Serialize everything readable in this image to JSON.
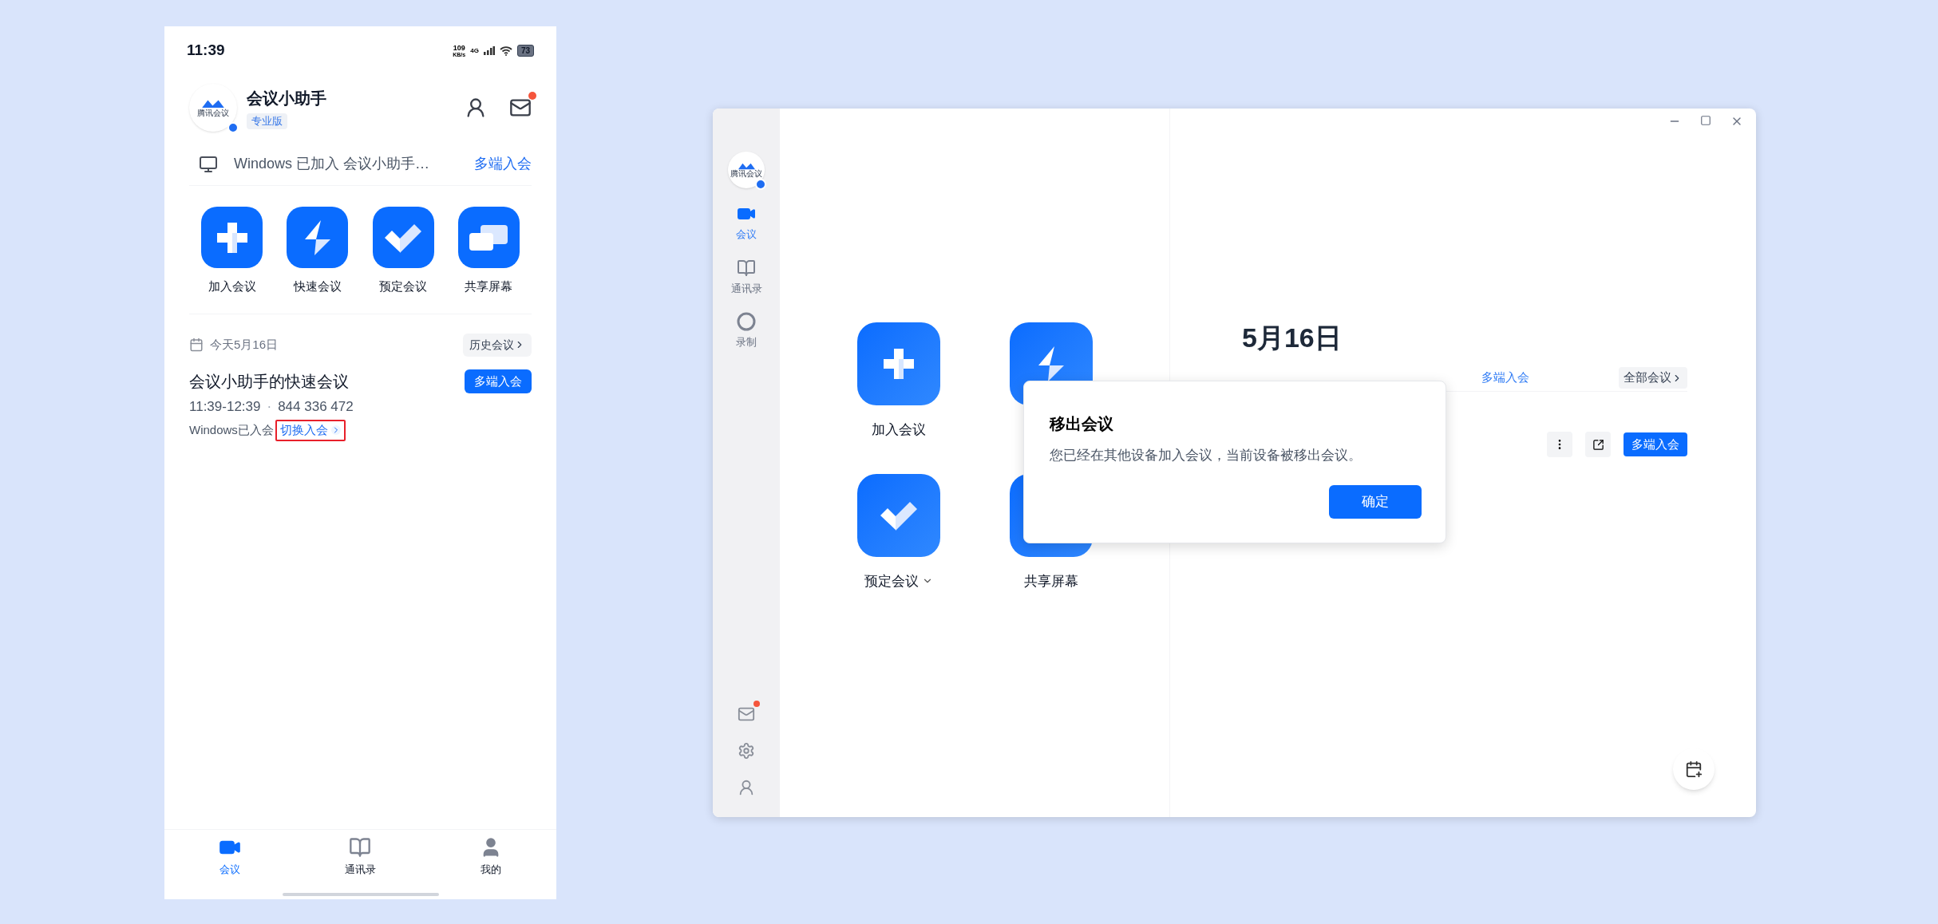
{
  "phone": {
    "status_bar": {
      "time": "11:39",
      "net_speed": "109",
      "net_unit": "KB/s",
      "network": "4G",
      "battery": "73"
    },
    "profile": {
      "logo_text": "腾讯会议",
      "name": "会议小助手",
      "badge": "专业版",
      "unread_mail": true
    },
    "banner": {
      "text": "Windows 已加入 会议小助手…",
      "action": "多端入会"
    },
    "actions": [
      {
        "kind": "join",
        "label": "加入会议"
      },
      {
        "kind": "quick",
        "label": "快速会议"
      },
      {
        "kind": "schedule",
        "label": "预定会议"
      },
      {
        "kind": "share",
        "label": "共享屏幕"
      }
    ],
    "date_label": "今天5月16日",
    "history_button": "历史会议",
    "meeting": {
      "title": "会议小助手的快速会议",
      "time": "11:39-12:39",
      "separator": "·",
      "id": "844 336 472",
      "status": "Windows已入会",
      "switch_link": "切换入会",
      "highlighted": true,
      "join_button": "多端入会"
    },
    "tabs": [
      {
        "kind": "meeting",
        "label": "会议",
        "selected": true
      },
      {
        "kind": "contacts",
        "label": "通讯录",
        "selected": false
      },
      {
        "kind": "me",
        "label": "我的",
        "selected": false
      }
    ]
  },
  "desktop": {
    "logo_text": "腾讯会议",
    "sidebar": {
      "items": [
        {
          "kind": "meeting",
          "label": "会议",
          "selected": true
        },
        {
          "kind": "contacts",
          "label": "通讯录",
          "selected": false
        },
        {
          "kind": "record",
          "label": "录制",
          "selected": false
        }
      ],
      "unread_mail": true
    },
    "actions": [
      {
        "kind": "join",
        "label": "加入会议",
        "dropdown": false
      },
      {
        "kind": "quick"
      },
      {
        "kind": "schedule",
        "label": "预定会议",
        "dropdown": true
      },
      {
        "kind": "share",
        "label": "共享屏幕",
        "dropdown": false
      }
    ],
    "date": "5月16日",
    "banner_action": "多端入会",
    "all_button": "全部会议",
    "join_button": "多端入会",
    "dialog": {
      "title": "移出会议",
      "message": "您已经在其他设备加入会议，当前设备被移出会议。",
      "confirm": "确定"
    }
  }
}
